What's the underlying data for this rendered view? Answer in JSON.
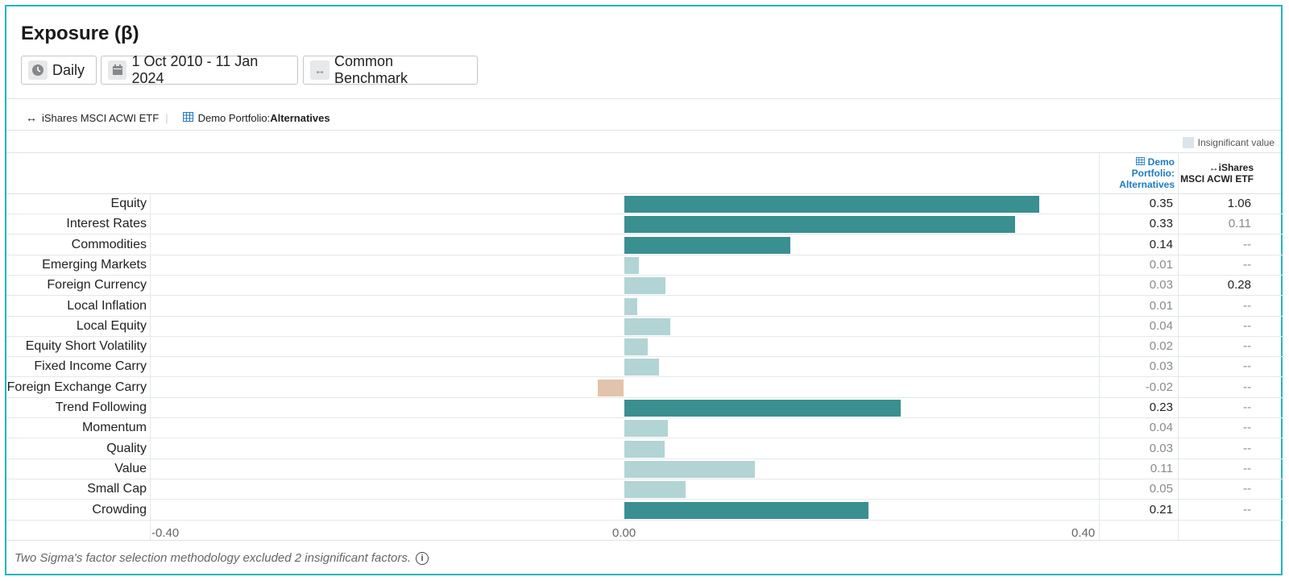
{
  "title": "Exposure (β)",
  "controls": {
    "frequency": "Daily",
    "date_range": "1 Oct 2010 - 11 Jan 2024",
    "benchmark": "Common Benchmark"
  },
  "legend": {
    "benchmark_name": "iShares MSCI ACWI ETF",
    "portfolio_prefix": "Demo Portfolio: ",
    "portfolio_name": "Alternatives"
  },
  "insignificant_label": "Insignificant value",
  "columns": {
    "portfolio_line1": "Demo",
    "portfolio_line2": "Portfolio:",
    "portfolio_line3": "Alternatives",
    "benchmark_line1": "iShares",
    "benchmark_line2": "MSCI ACWI ETF"
  },
  "colors": {
    "significant": "#3a8f91",
    "insignificant": "#b3d4d4",
    "negative": "#e2c3ab",
    "accent": "#1f7ac4"
  },
  "chart_data": {
    "type": "bar",
    "orientation": "horizontal",
    "xlim": [
      -0.4,
      0.4
    ],
    "x_ticks": [
      "-0.40",
      "0.00",
      "0.40"
    ],
    "categories": [
      "Equity",
      "Interest Rates",
      "Commodities",
      "Emerging Markets",
      "Foreign Currency",
      "Local Inflation",
      "Local Equity",
      "Equity Short Volatility",
      "Fixed Income Carry",
      "Foreign Exchange Carry",
      "Trend Following",
      "Momentum",
      "Quality",
      "Value",
      "Small Cap",
      "Crowding"
    ],
    "values": [
      0.35,
      0.33,
      0.14,
      0.012,
      0.035,
      0.011,
      0.039,
      0.02,
      0.029,
      -0.022,
      0.233,
      0.037,
      0.034,
      0.11,
      0.052,
      0.206
    ],
    "significant": [
      true,
      true,
      true,
      false,
      false,
      false,
      false,
      false,
      false,
      false,
      true,
      false,
      false,
      false,
      false,
      true
    ],
    "portfolio_labels": [
      "0.35",
      "0.33",
      "0.14",
      "0.01",
      "0.03",
      "0.01",
      "0.04",
      "0.02",
      "0.03",
      "-0.02",
      "0.23",
      "0.04",
      "0.03",
      "0.11",
      "0.05",
      "0.21"
    ],
    "benchmark_labels": [
      "1.06",
      "0.11",
      "--",
      "--",
      "0.28",
      "--",
      "--",
      "--",
      "--",
      "--",
      "--",
      "--",
      "--",
      "--",
      "--",
      "--"
    ],
    "benchmark_significant": [
      true,
      false,
      false,
      false,
      true,
      false,
      false,
      false,
      false,
      false,
      false,
      false,
      false,
      false,
      false,
      false
    ]
  },
  "footnote": "Two Sigma's factor selection methodology excluded 2 insignificant factors."
}
